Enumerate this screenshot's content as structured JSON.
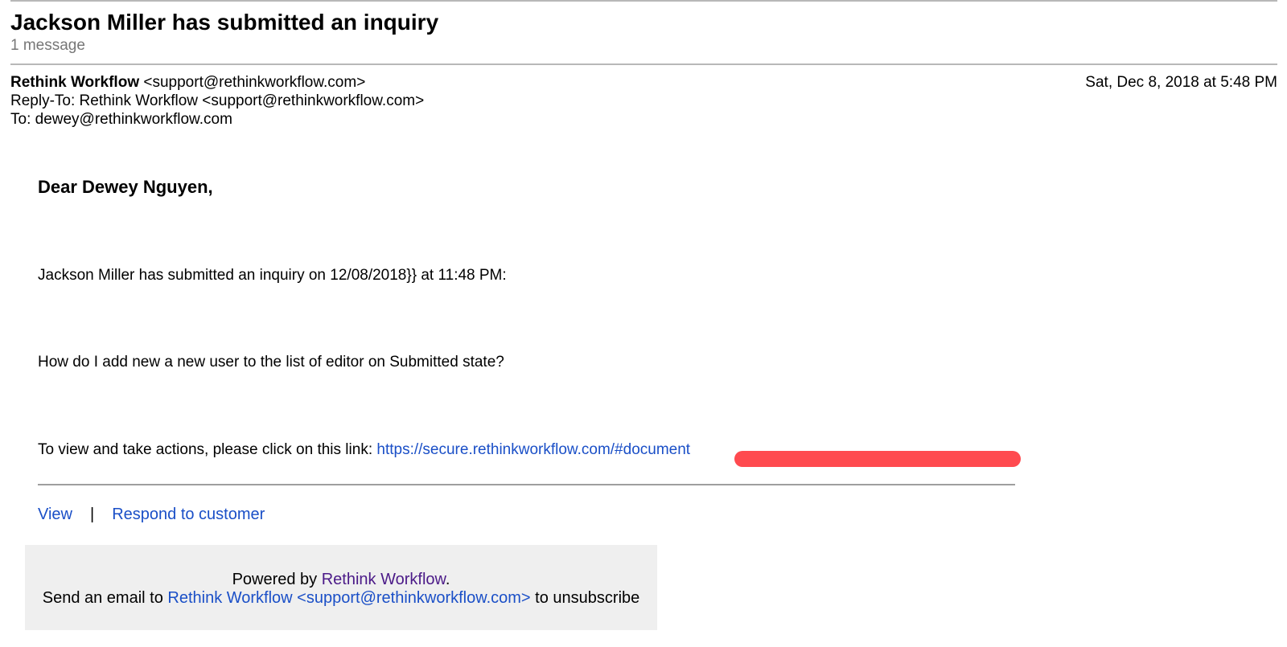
{
  "thread": {
    "subject": "Jackson Miller has submitted an inquiry",
    "message_count": "1 message"
  },
  "header": {
    "from_name": "Rethink Workflow",
    "from_email": " <support@rethinkworkflow.com>",
    "reply_to": "Reply-To: Rethink Workflow <support@rethinkworkflow.com>",
    "to": "To: dewey@rethinkworkflow.com",
    "date": "Sat, Dec 8, 2018 at 5:48 PM"
  },
  "body": {
    "greeting": "Dear Dewey Nguyen,",
    "line1": "Jackson Miller has submitted an inquiry on 12/08/2018}} at 11:48 PM:",
    "line2": "How do I add new a new user to the list of editor on Submitted state?",
    "line3_prefix": "To view and take actions, please click on this link: ",
    "link_text": "https://secure.rethinkworkflow.com/#document"
  },
  "actions": {
    "view_label": "View",
    "separator": "|",
    "respond_label": "Respond to customer"
  },
  "footer": {
    "powered_prefix": "Powered by ",
    "brand": "Rethink Workflow",
    "powered_suffix": ".",
    "unsubscribe_prefix": "Send an email to ",
    "unsubscribe_link": "Rethink Workflow <support@rethinkworkflow.com>",
    "unsubscribe_suffix": " to unsubscribe"
  },
  "colors": {
    "link": "#1a4fc7",
    "brand_link": "#4b1a88",
    "redaction": "#ff4a4f",
    "footer_bg": "#efefef"
  }
}
